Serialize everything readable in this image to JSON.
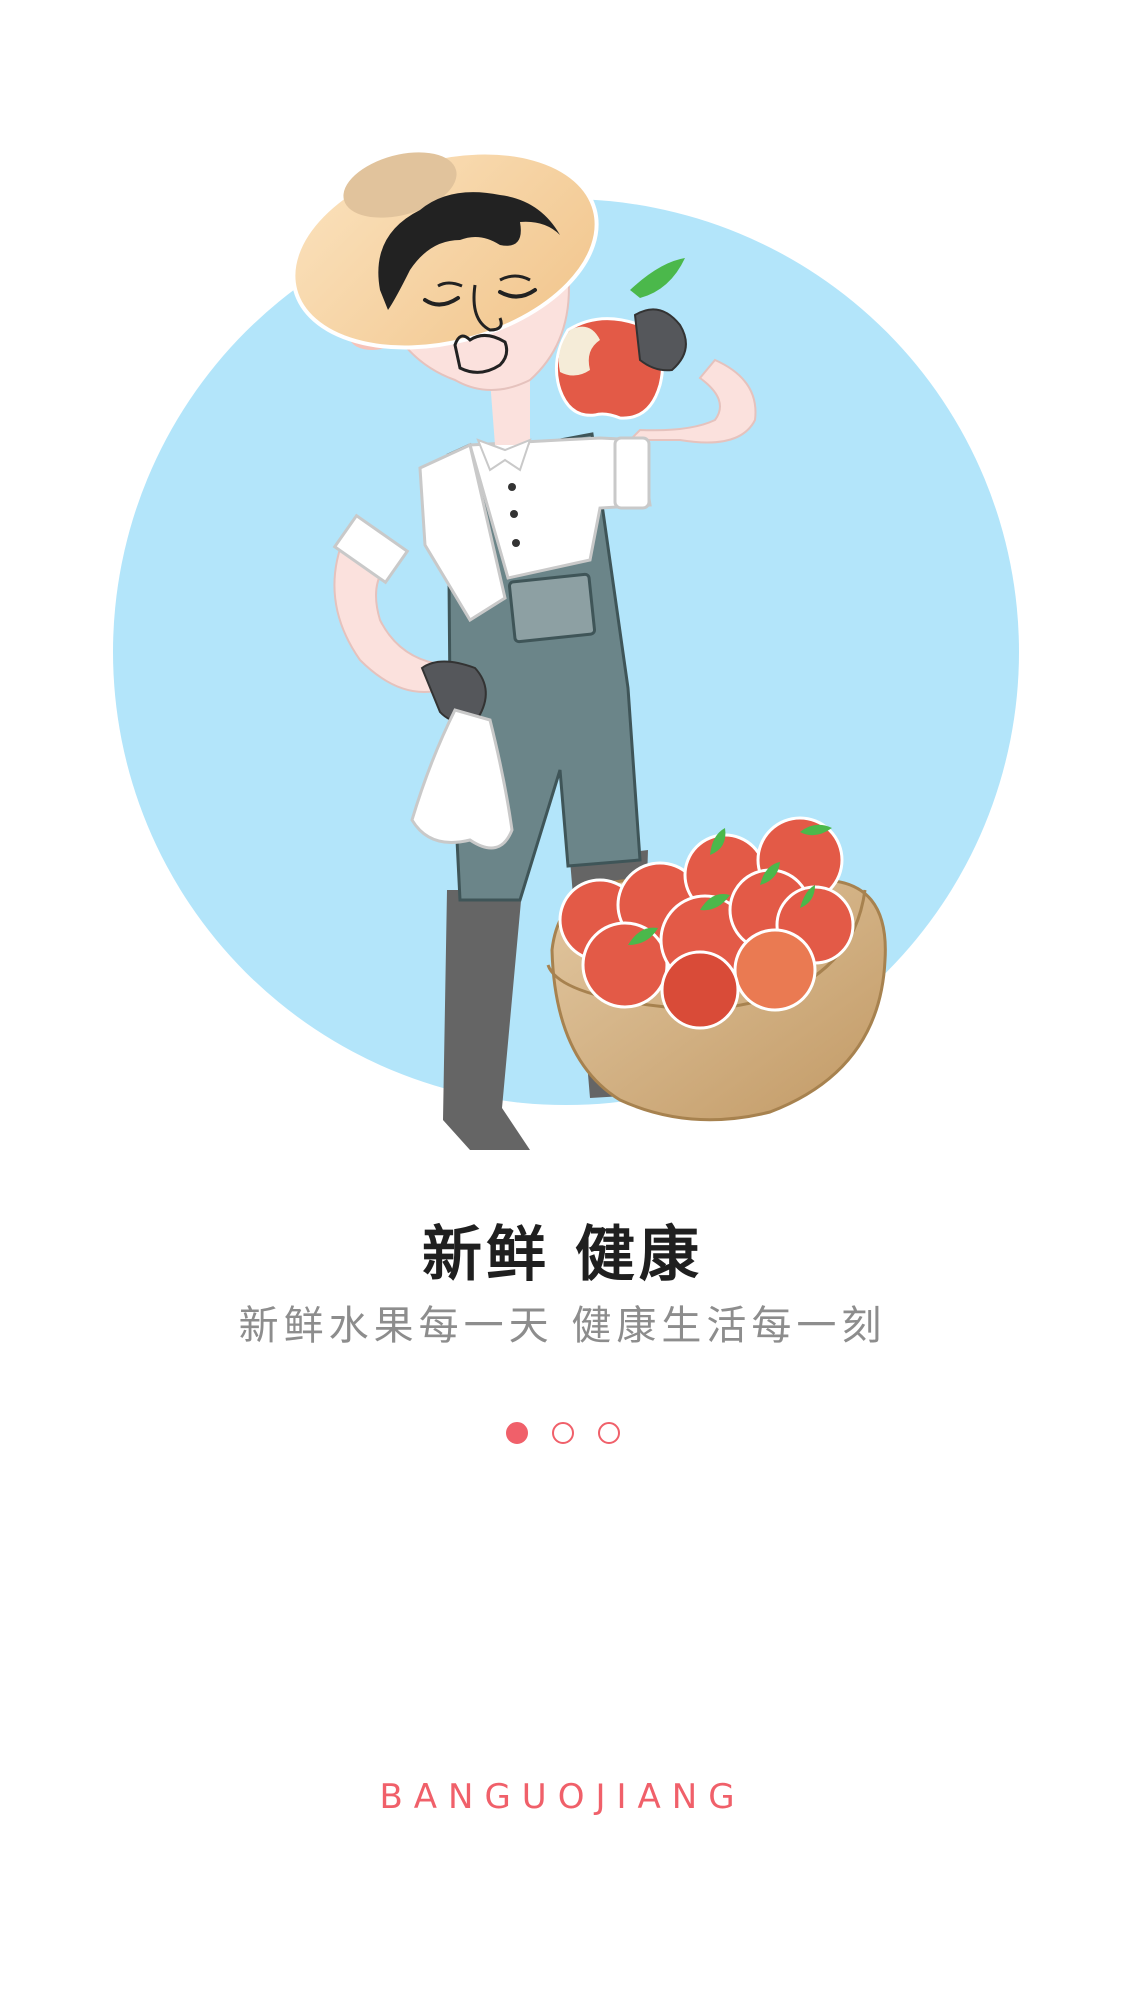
{
  "onboarding": {
    "title": "新鲜 健康",
    "subtitle": "新鲜水果每一天 健康生活每一刻",
    "page_indicator": {
      "total": 3,
      "current": 1
    }
  },
  "footer": {
    "brand": "BANGUOJIANG"
  },
  "illustration": {
    "subject": "farmer-eating-apple-with-apple-basket",
    "colors": {
      "circle": "#b3e5fa",
      "apple": "#e35a47",
      "overalls": "#6b8589",
      "basket": "#cfa978",
      "hat": "#f6d3a0"
    }
  },
  "colors": {
    "accent": "#f0606a",
    "title": "#1f1f1f",
    "subtitle": "#8d8d8d"
  }
}
